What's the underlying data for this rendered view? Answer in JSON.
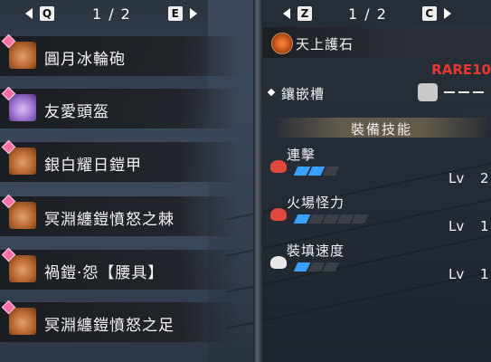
{
  "left_pager": {
    "key_left": "Q",
    "key_right": "E",
    "page": "1",
    "sep": "/",
    "total": "2"
  },
  "right_pager": {
    "key_left": "Z",
    "key_right": "C",
    "page": "1",
    "sep": "/",
    "total": "2"
  },
  "equipment": [
    {
      "label": "圓月冰輪砲"
    },
    {
      "label": "友愛頭盔"
    },
    {
      "label": "銀白耀日鎧甲"
    },
    {
      "label": "冥淵纏鎧憤怒之棘"
    },
    {
      "label": "禍鎧‧怨【腰具】"
    },
    {
      "label": "冥淵纏鎧憤怒之足"
    }
  ],
  "details": {
    "title": "天上護石",
    "rarity": "RARE10",
    "slot_label": "鑲嵌槽",
    "skills_header": "裝備技能",
    "skills": [
      {
        "name": "連擊",
        "lv_label": "Lv",
        "level": "2",
        "filled": 2,
        "max": 3
      },
      {
        "name": "火場怪力",
        "lv_label": "Lv",
        "level": "1",
        "filled": 1,
        "max": 5
      },
      {
        "name": "裝填速度",
        "lv_label": "Lv",
        "level": "1",
        "filled": 1,
        "max": 3
      }
    ]
  }
}
